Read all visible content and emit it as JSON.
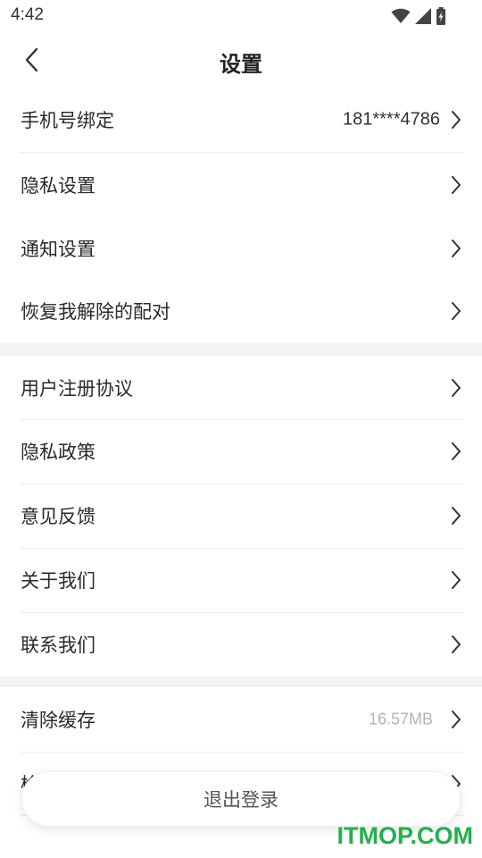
{
  "status_bar": {
    "time": "4:42",
    "icons": [
      "wifi-icon",
      "signal-icon",
      "battery-charging-icon"
    ]
  },
  "header": {
    "title": "设置",
    "back_icon": "chevron-left-icon"
  },
  "sections": [
    {
      "items": [
        {
          "label": "手机号绑定",
          "value": "181****4786"
        },
        {
          "label": "隐私设置"
        },
        {
          "label": "通知设置"
        },
        {
          "label": "恢复我解除的配对"
        }
      ]
    },
    {
      "items": [
        {
          "label": "用户注册协议"
        },
        {
          "label": "隐私政策"
        },
        {
          "label": "意见反馈"
        },
        {
          "label": "关于我们"
        },
        {
          "label": "联系我们"
        }
      ]
    },
    {
      "items": [
        {
          "label": "清除缓存",
          "value": "16.57MB"
        },
        {
          "label": "检"
        }
      ]
    }
  ],
  "logout": {
    "label": "退出登录"
  },
  "watermark": "ITMOP.COM",
  "colors": {
    "section_gap": "#f4f4f4",
    "divider": "#ececec",
    "muted_value": "#b3b3b3",
    "watermark": "#22b14c"
  }
}
